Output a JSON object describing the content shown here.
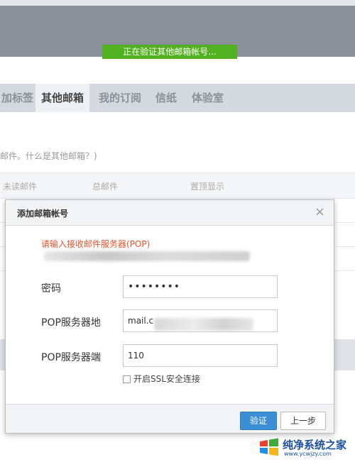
{
  "banner": {
    "status_text": "正在验证其他邮箱帐号..."
  },
  "tabs": [
    {
      "label": "加标签"
    },
    {
      "label": "其他邮箱"
    },
    {
      "label": "我的订阅"
    },
    {
      "label": "信纸"
    },
    {
      "label": "体验室"
    }
  ],
  "info": {
    "text": "邮件。什么是其他邮箱？)"
  },
  "columns": [
    "未读邮件",
    "总邮件",
    "置顶显示"
  ],
  "dialog": {
    "title": "添加邮箱帐号",
    "hint": "请输入接收邮件服务器(POP)",
    "password_label": "密码",
    "password_value": "••••••••",
    "pop_server_label": "POP服务器地",
    "pop_server_value": "mail.c",
    "pop_port_label": "POP服务器端",
    "pop_port_value": "110",
    "ssl_label": "开启SSL安全连接",
    "confirm_button": "验证",
    "back_button": "上一步"
  },
  "watermark": {
    "title": "纯净系统之家",
    "url": "www.ycwjzy.com"
  },
  "colors": {
    "accent_green": "#52b11f",
    "primary_blue": "#3b8ed6",
    "hint_red": "#e4532b"
  }
}
